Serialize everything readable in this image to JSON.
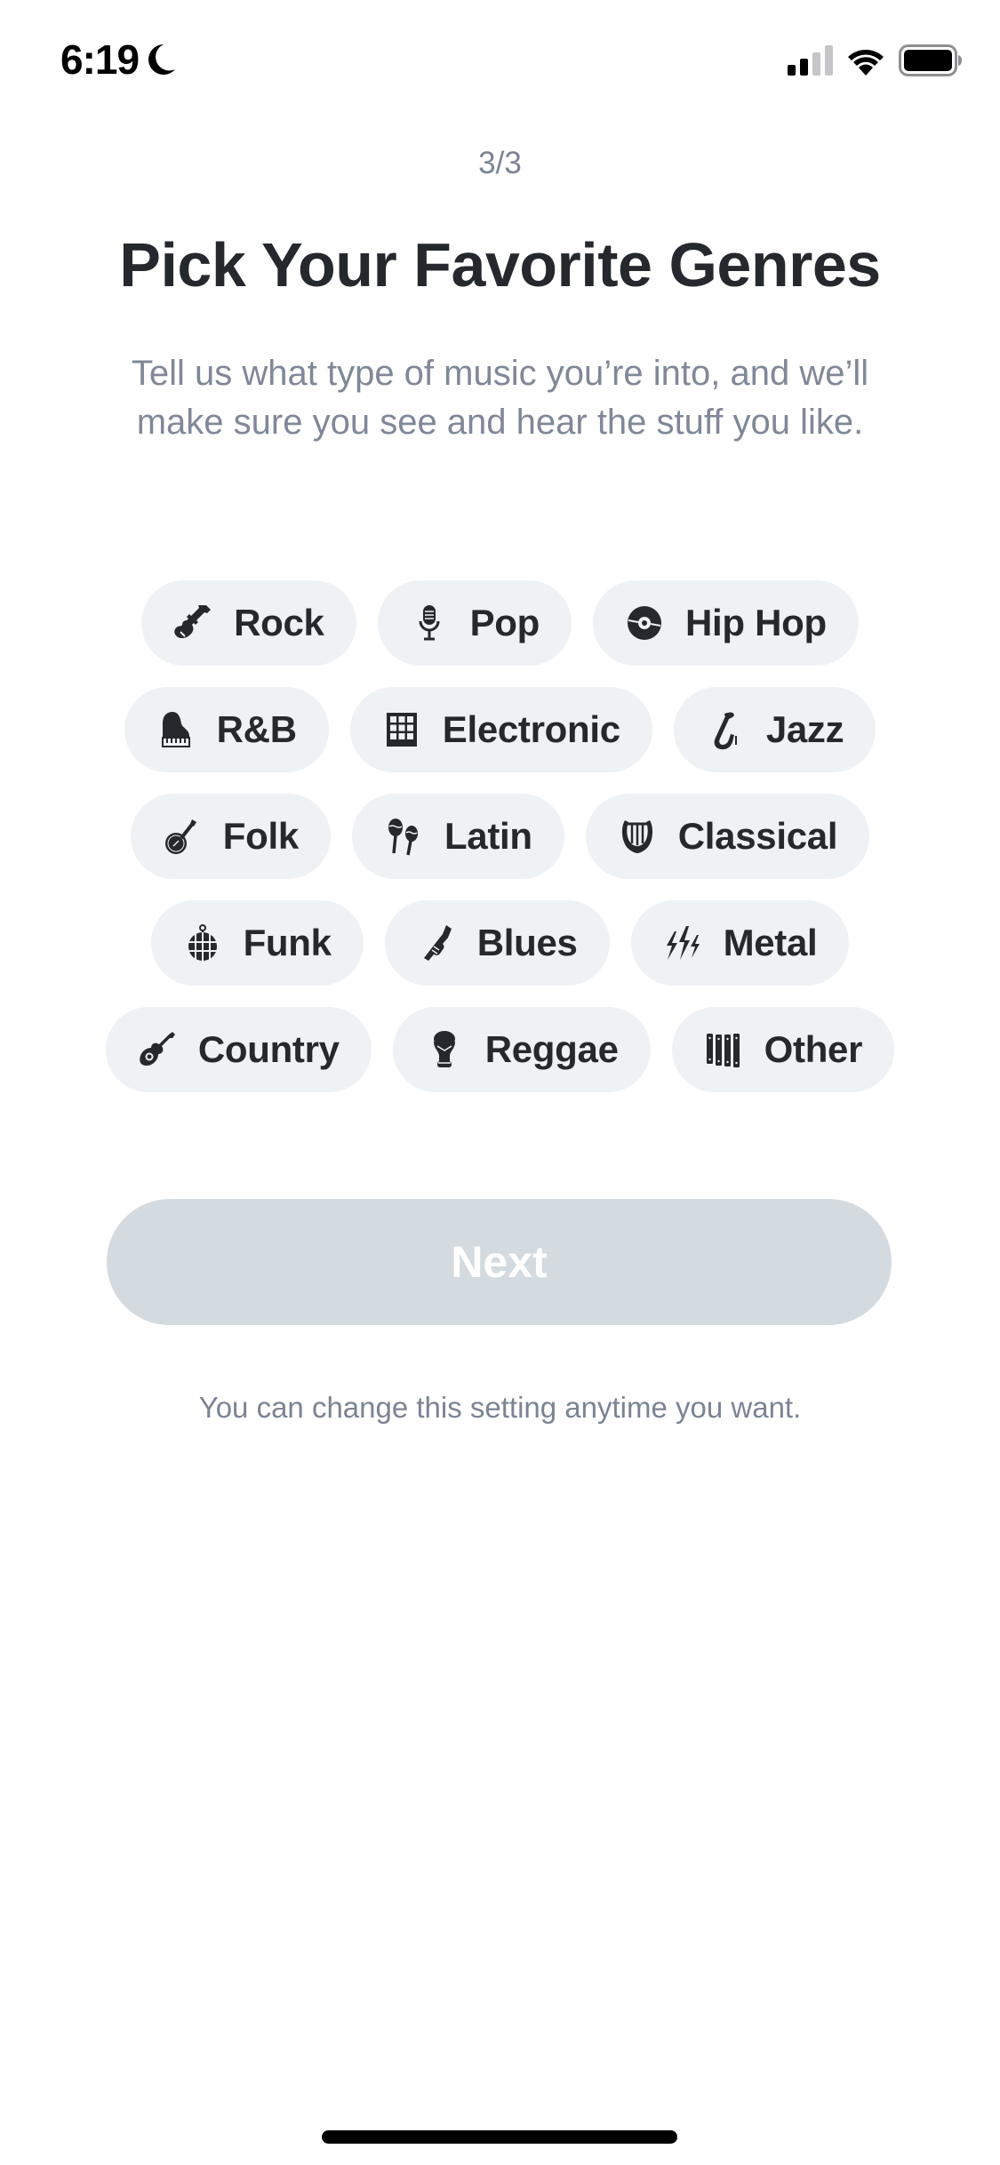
{
  "status_bar": {
    "time": "6:19",
    "focus_icon": "moon-icon",
    "signal_bars_active": 2,
    "signal_bars_total": 4,
    "wifi_icon": "wifi-icon",
    "battery_icon": "battery-icon"
  },
  "header": {
    "step": "3/3",
    "title": "Pick Your Favorite Genres",
    "subtitle": "Tell us what type of music you’re into, and we’ll make sure you see and hear the stuff you like."
  },
  "genres": {
    "rows": [
      [
        {
          "label": "Rock",
          "icon": "electric-guitar-icon",
          "selected": false
        },
        {
          "label": "Pop",
          "icon": "microphone-icon",
          "selected": false
        },
        {
          "label": "Hip Hop",
          "icon": "vinyl-record-icon",
          "selected": false
        }
      ],
      [
        {
          "label": "R&B",
          "icon": "grand-piano-icon",
          "selected": false
        },
        {
          "label": "Electronic",
          "icon": "drum-pad-icon",
          "selected": false
        },
        {
          "label": "Jazz",
          "icon": "saxophone-icon",
          "selected": false
        }
      ],
      [
        {
          "label": "Folk",
          "icon": "banjo-icon",
          "selected": false
        },
        {
          "label": "Latin",
          "icon": "maracas-icon",
          "selected": false
        },
        {
          "label": "Classical",
          "icon": "lyre-icon",
          "selected": false
        }
      ],
      [
        {
          "label": "Funk",
          "icon": "disco-ball-icon",
          "selected": false
        },
        {
          "label": "Blues",
          "icon": "trumpet-icon",
          "selected": false
        },
        {
          "label": "Metal",
          "icon": "lightning-icon",
          "selected": false
        }
      ],
      [
        {
          "label": "Country",
          "icon": "acoustic-guitar-icon",
          "selected": false
        },
        {
          "label": "Reggae",
          "icon": "bongo-drum-icon",
          "selected": false
        },
        {
          "label": "Other",
          "icon": "xylophone-icon",
          "selected": false
        }
      ]
    ]
  },
  "actions": {
    "next_label": "Next",
    "next_enabled": false
  },
  "footer": {
    "note": "You can change this setting anytime you want."
  },
  "colors": {
    "text_primary": "#25282d",
    "text_secondary": "#7b8494",
    "chip_bg": "#eff2f5",
    "button_disabled_bg": "#d3dae0"
  }
}
